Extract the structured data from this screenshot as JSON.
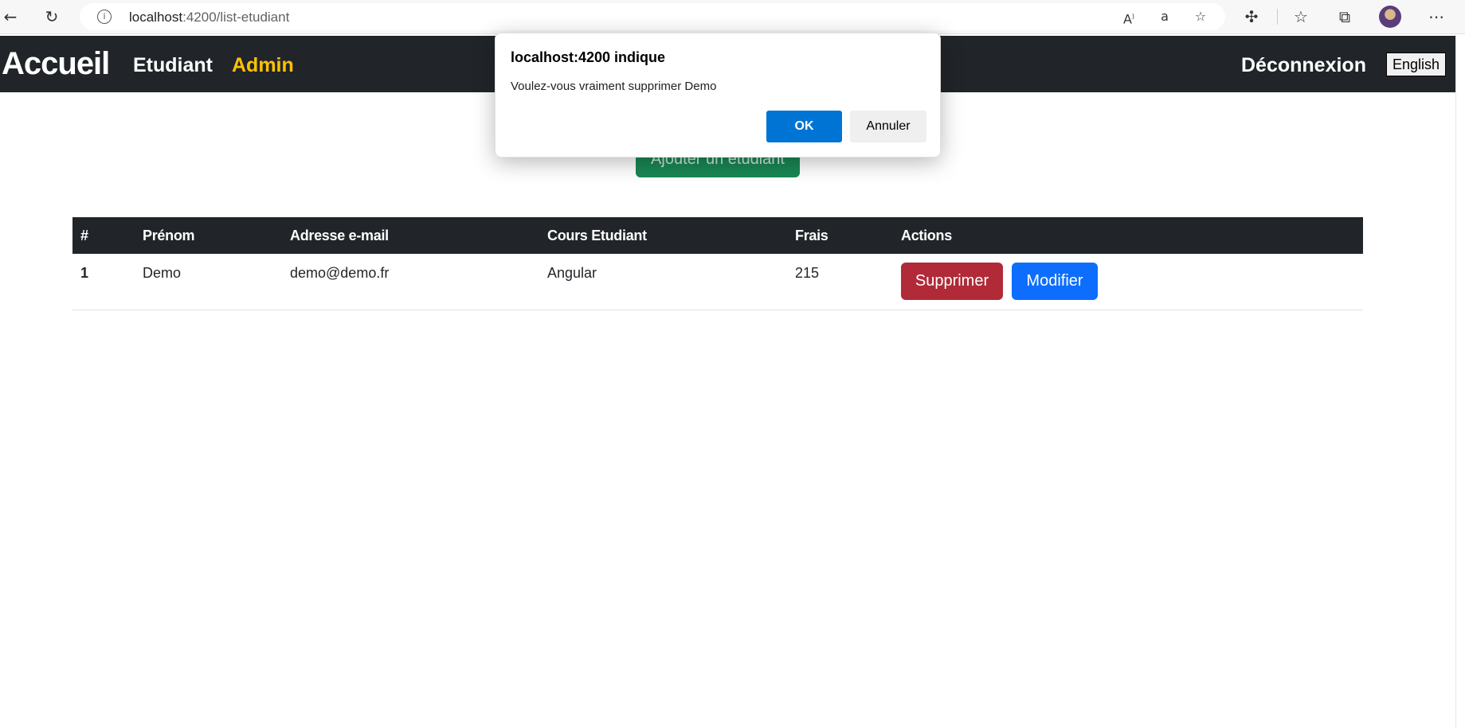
{
  "browser": {
    "url_host": "localhost",
    "url_path": ":4200/list-etudiant",
    "icons": [
      "back-icon",
      "refresh-icon",
      "info-icon",
      "read-aloud-icon",
      "translate-icon",
      "favorite-add-icon",
      "extensions-icon",
      "favorites-icon",
      "collections-icon",
      "avatar",
      "more-icon"
    ]
  },
  "navbar": {
    "brand": "Accueil",
    "links": [
      {
        "label": "Etudiant",
        "active": false
      },
      {
        "label": "Admin",
        "active": true
      }
    ],
    "logout": "Déconnexion",
    "language": "English"
  },
  "main": {
    "add_button": "Ajouter un étudiant"
  },
  "table": {
    "headers": [
      "#",
      "Prénom",
      "Adresse e-mail",
      "Cours Etudiant",
      "Frais",
      "Actions"
    ],
    "rows": [
      {
        "idx": "1",
        "prenom": "Demo",
        "email": "demo@demo.fr",
        "cours": "Angular",
        "frais": "215",
        "delete_label": "Supprimer",
        "edit_label": "Modifier"
      }
    ]
  },
  "dialog": {
    "title": "localhost:4200 indique",
    "message": "Voulez-vous vraiment supprimer Demo",
    "ok": "OK",
    "cancel": "Annuler"
  },
  "colors": {
    "navbar_bg": "#212529",
    "active_link": "#ffc107",
    "danger": "#b02a37",
    "primary": "#0d6efd",
    "success": "#198754",
    "dialog_ok": "#0074d4"
  }
}
